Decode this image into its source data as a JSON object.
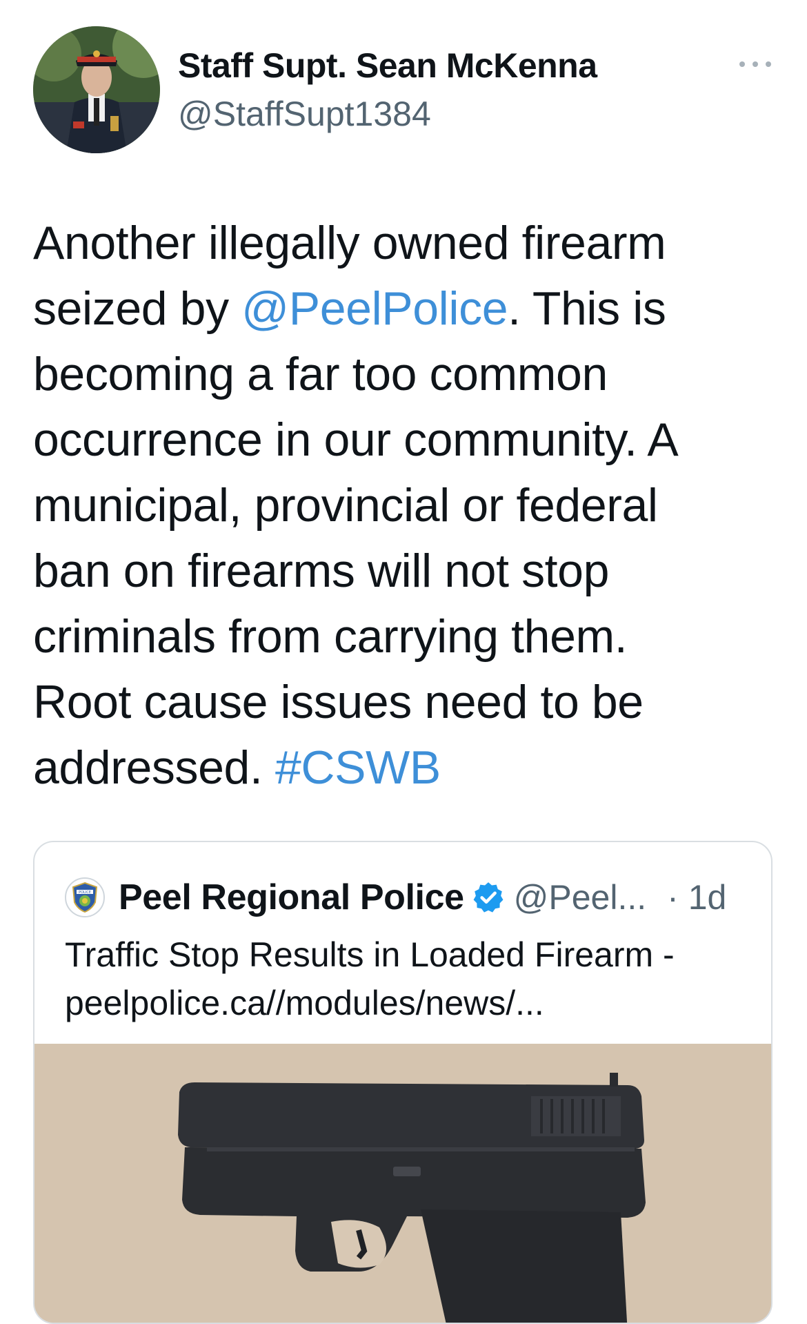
{
  "author": {
    "name": "Staff Supt. Sean McKenna",
    "handle": "@StaffSupt1384"
  },
  "tweet": {
    "lines": [
      {
        "text": "Another illegally owned firearm"
      },
      {
        "pre": "seized by ",
        "link": "@PeelPolice",
        "post": ". This is"
      },
      {
        "text": "becoming a far too common"
      },
      {
        "text": "occurrence in our community. A"
      },
      {
        "text": "municipal, provincial or federal"
      },
      {
        "text": "ban on firearms will not stop"
      },
      {
        "text": "criminals from carrying them."
      },
      {
        "text": "Root cause issues need to be"
      },
      {
        "pre": "addressed. ",
        "link": "#CSWB",
        "post": ""
      }
    ]
  },
  "quote": {
    "name": "Peel Regional Police",
    "handle": "@Peel...",
    "time": "· 1d",
    "text_line1": "Traffic Stop Results in Loaded Firearm -",
    "text_line2": "peelpolice.ca//modules/news/...",
    "avatar_logo_text": "POLICE",
    "image_subject": "handgun-photo"
  },
  "colors": {
    "link": "#3e8fd8",
    "secondary_text": "#536471",
    "verified": "#1d9bf0",
    "image_background": "#d8c8b4"
  },
  "icons": [
    "more-options-icon",
    "verified-badge-icon"
  ]
}
